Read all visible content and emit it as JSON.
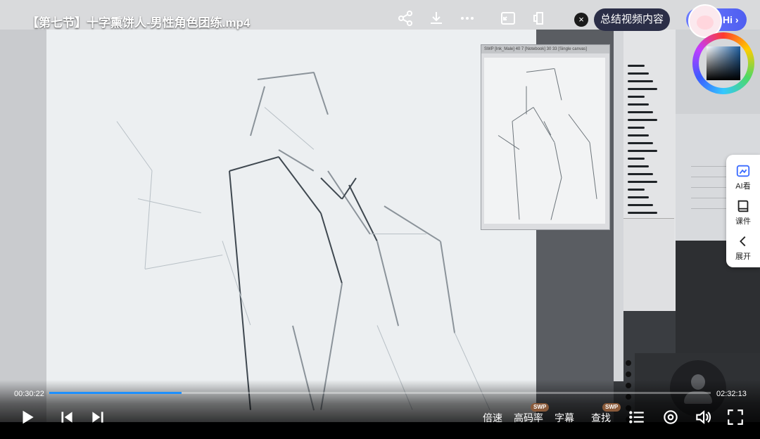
{
  "video": {
    "title": "【第七节】十字熏饼人-男性角色团练.mp4",
    "summary_button": "总结视频内容",
    "close_glyph": "×",
    "assistant_label": "Hi",
    "assistant_chevron": "›"
  },
  "side_panel": {
    "items": [
      {
        "label": "AI看",
        "icon": "ai-view-icon"
      },
      {
        "label": "课件",
        "icon": "courseware-icon"
      },
      {
        "label": "展开",
        "icon": "chevron-left-icon"
      }
    ]
  },
  "player": {
    "current_time": "00:30:22",
    "total_time": "02:32:13",
    "progress_fraction": 0.2,
    "accent_color": "#1e90ff",
    "speed_label": "倍速",
    "bitrate_label": "高码率",
    "subtitle_label": "字幕",
    "search_label": "查找",
    "badge_label": "SWP"
  },
  "app_window": {
    "navigator_title": "SWP [Ink_Male] 40 7 [Notebook] 30 33 [Single canvas]"
  }
}
